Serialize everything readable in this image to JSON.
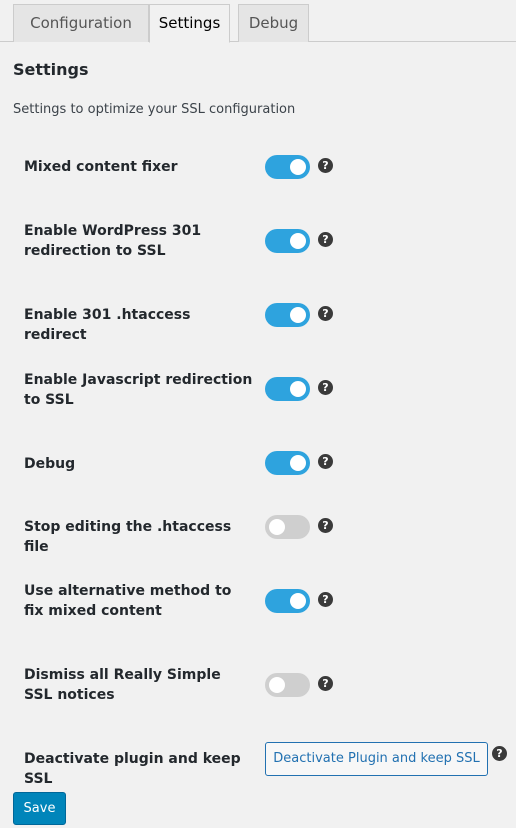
{
  "tabs": [
    "Configuration",
    "Settings",
    "Debug"
  ],
  "active_tab": "Settings",
  "page": {
    "title": "Settings",
    "description": "Settings to optimize your SSL configuration"
  },
  "settings": [
    {
      "label": "Mixed content fixer",
      "enabled": true
    },
    {
      "label": "Enable WordPress 301 redirection to SSL",
      "enabled": true
    },
    {
      "label": "Enable 301 .htaccess redirect",
      "enabled": true
    },
    {
      "label": "Enable Javascript redirection to SSL",
      "enabled": true
    },
    {
      "label": "Debug",
      "enabled": true
    },
    {
      "label": "Stop editing the .htaccess file",
      "enabled": false
    },
    {
      "label": "Use alternative method to fix mixed content",
      "enabled": true
    },
    {
      "label": "Dismiss all Really Simple SSL notices",
      "enabled": false
    },
    {
      "label": "Deactivate plugin and keep SSL"
    }
  ],
  "help_glyph": "?",
  "deactivate_button": "Deactivate Plugin and keep SSL",
  "save_button": "Save",
  "colors": {
    "toggle_on": "#2ea3de",
    "toggle_off": "#cfcfcf",
    "primary_button": "#0085ba"
  },
  "icons": {
    "help": "question-circle-icon"
  }
}
